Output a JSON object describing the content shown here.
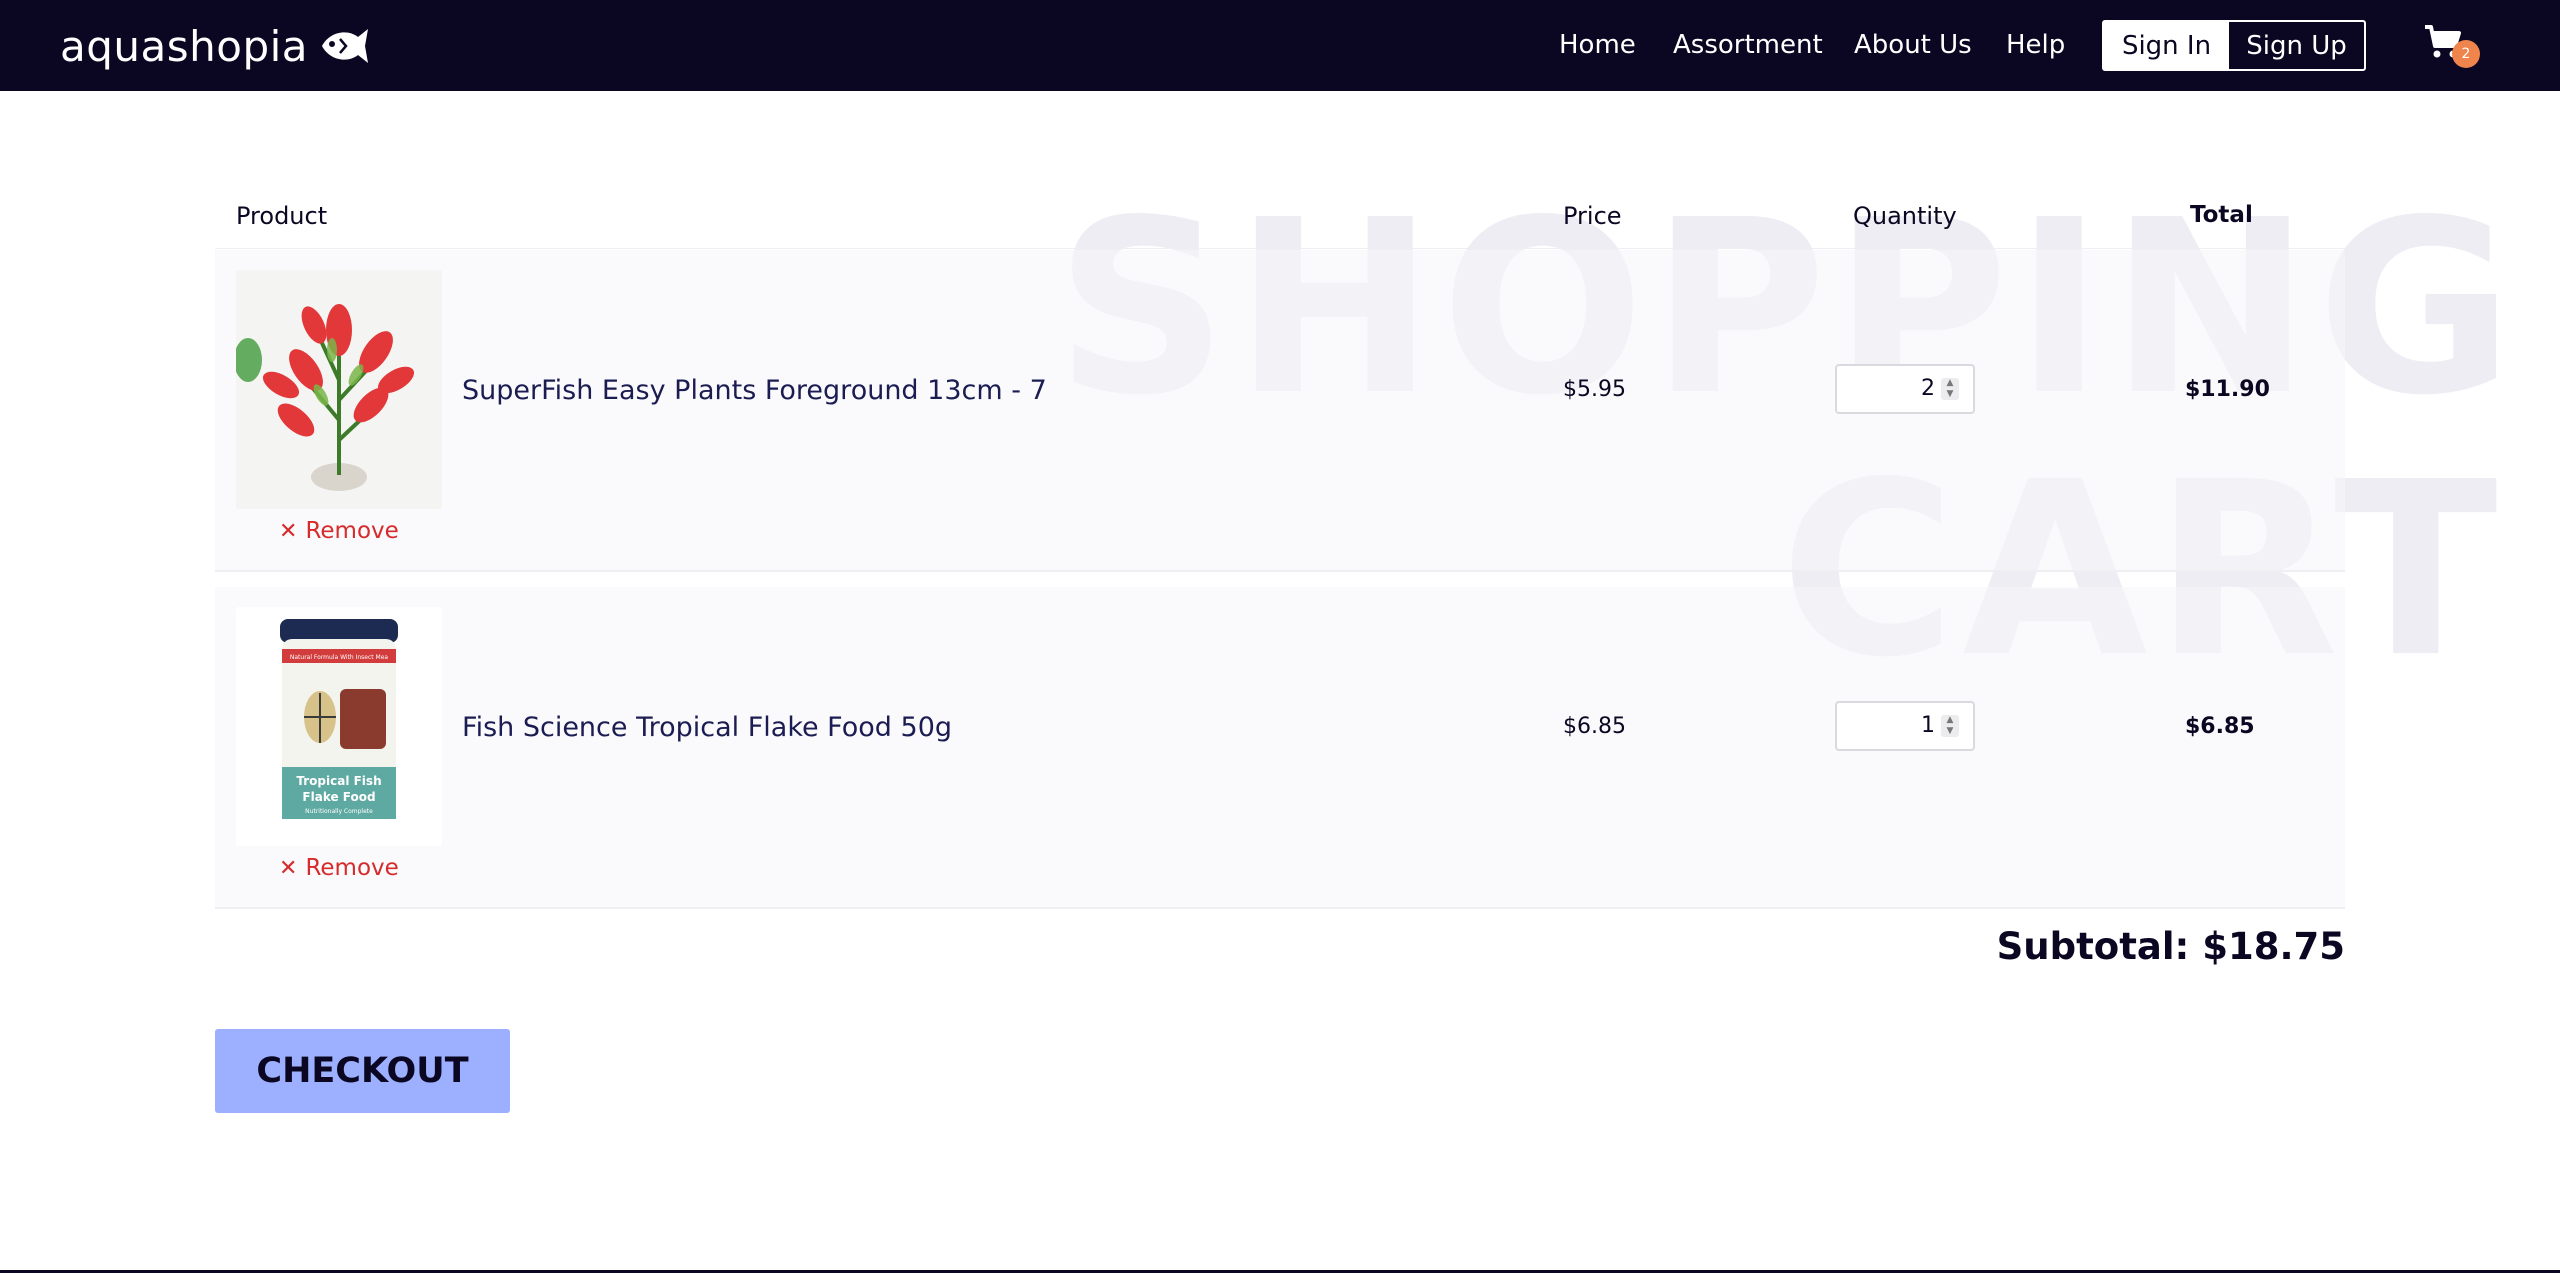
{
  "navbar": {
    "brand": "aquashopia",
    "links": [
      "Home",
      "Assortment",
      "About Us",
      "Help"
    ],
    "sign_in": "Sign In",
    "sign_up": "Sign Up",
    "cart_count": "2"
  },
  "watermark": {
    "line1": "SHOPPING",
    "line2": "CART"
  },
  "table": {
    "headers": {
      "product": "Product",
      "price": "Price",
      "quantity": "Quantity",
      "total": "Total"
    },
    "items": [
      {
        "name": "SuperFish Easy Plants Foreground 13cm - 7",
        "price": "$5.95",
        "quantity": "2",
        "total": "$11.90",
        "remove": "Remove",
        "image_icon": "plant-image"
      },
      {
        "name": "Fish Science Tropical Flake Food 50g",
        "price": "$6.85",
        "quantity": "1",
        "total": "$6.85",
        "remove": "Remove",
        "image_icon": "fish-food-jar-image"
      }
    ]
  },
  "product_image_text": {
    "jar_band": "Natural Formula With Insect Mea",
    "jar_title1": "Tropical Fish",
    "jar_title2": "Flake Food",
    "jar_sub": "Nutritionally Complete"
  },
  "subtotal": "Subtotal: $18.75",
  "checkout": "CHECKOUT",
  "colors": {
    "nav_bg": "#0b0722",
    "badge": "#f0844d",
    "remove": "#d62b2b",
    "checkout_bg": "#9cb0ff",
    "product_link": "#1b1c52"
  }
}
